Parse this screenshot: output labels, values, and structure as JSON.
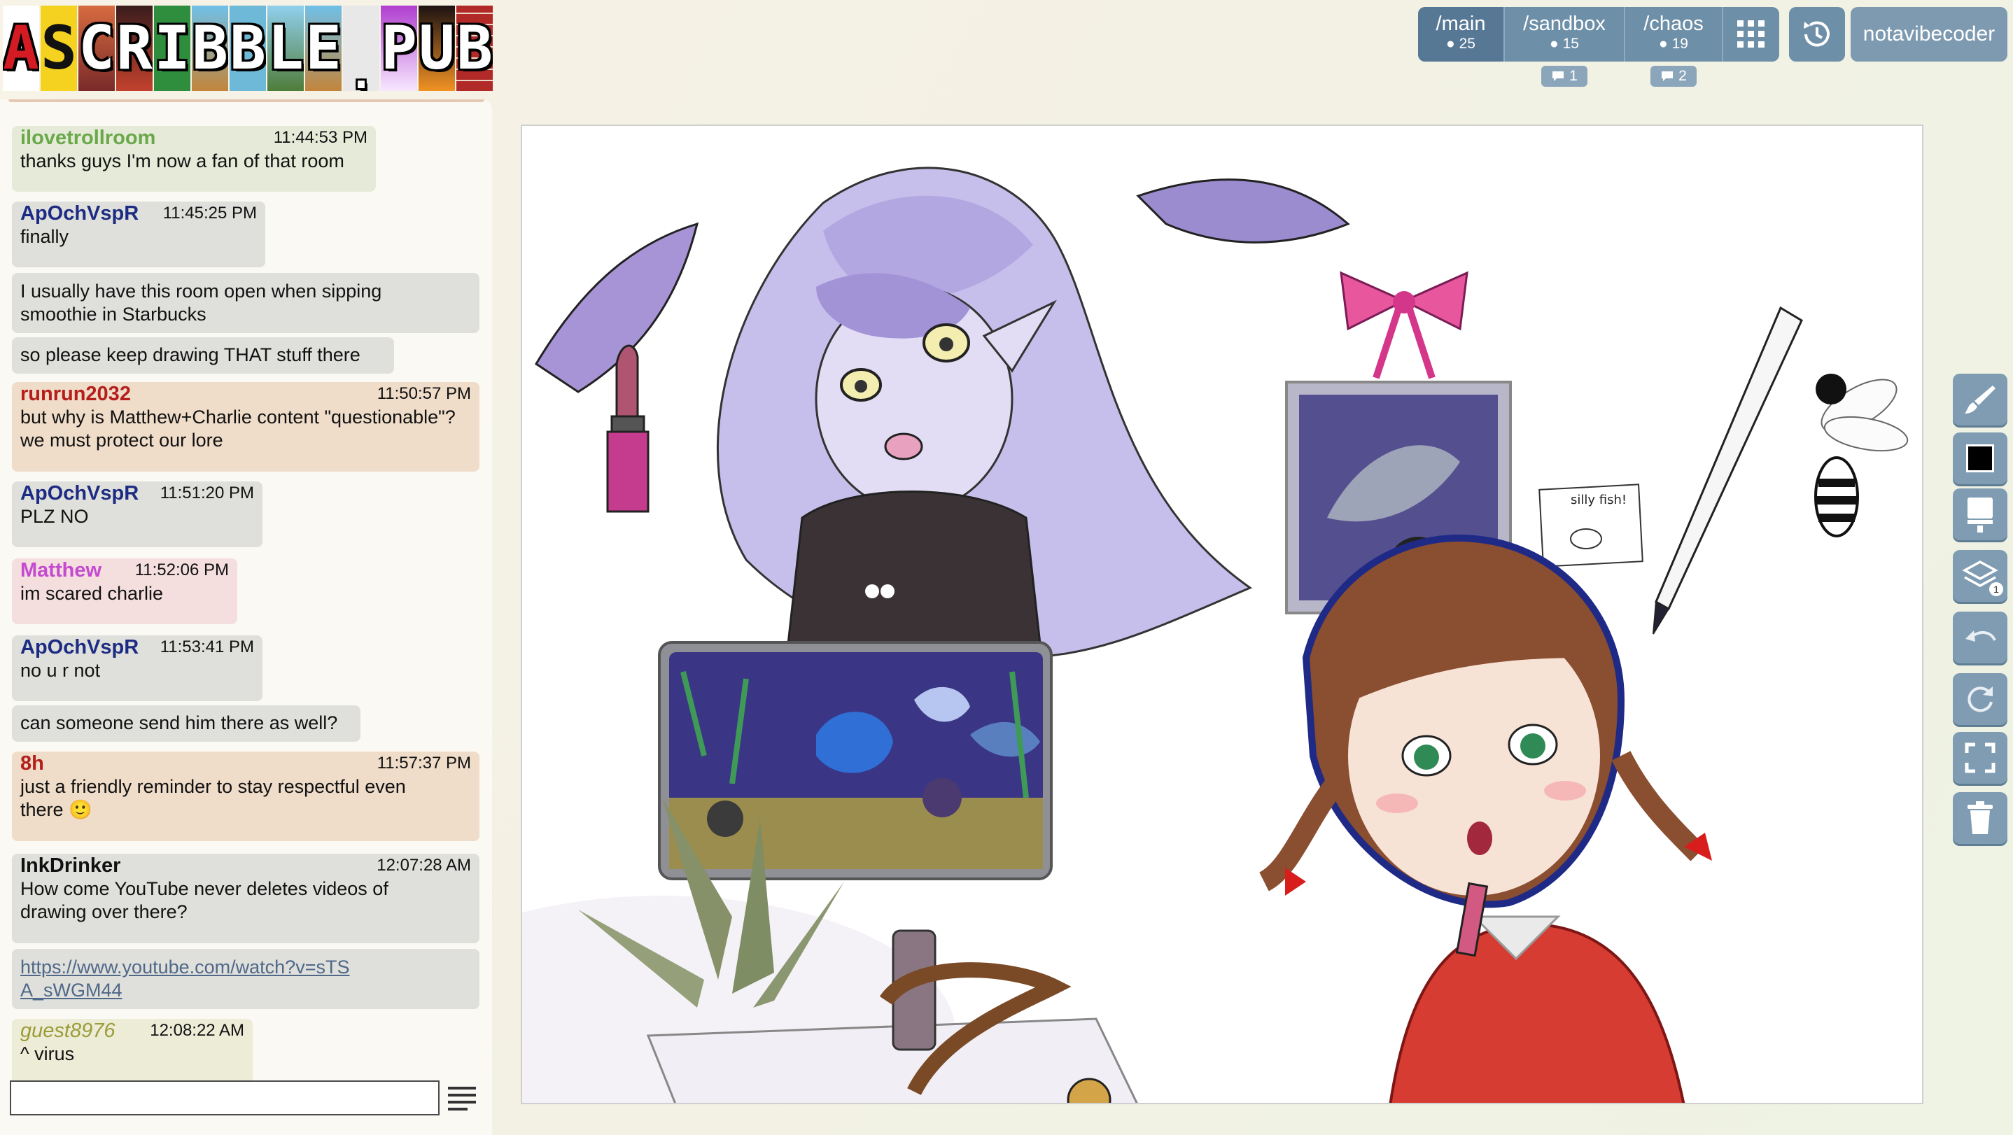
{
  "logo": {
    "text": "SCRIBBLE.PUB",
    "letters": [
      "A",
      "S",
      "C",
      "R",
      "I",
      "B",
      "B",
      "L",
      "E",
      ".",
      "P",
      "U",
      "B"
    ]
  },
  "header": {
    "rooms": [
      {
        "name": "/main",
        "count": "25"
      },
      {
        "name": "/sandbox",
        "count": "15",
        "unread": "1"
      },
      {
        "name": "/chaos",
        "count": "19",
        "unread": "2"
      }
    ],
    "username": "notavibecoder"
  },
  "chat": {
    "input_value": "",
    "messages": [
      {
        "user": "ilovetrollroom",
        "time": "11:44:53 PM",
        "text": "thanks guys I'm now a fan of that room"
      },
      {
        "user": "ApOchVspR",
        "time": "11:45:25 PM",
        "text": "finally"
      },
      {
        "text": "I usually have this room open when sipping smoothie in Starbucks"
      },
      {
        "text": "so please keep drawing THAT stuff there"
      },
      {
        "user": "runrun2032",
        "time": "11:50:57 PM",
        "text": "but why is Matthew+Charlie content \"questionable\"? we must protect our lore"
      },
      {
        "user": "ApOchVspR",
        "time": "11:51:20 PM",
        "text": "PLZ NO"
      },
      {
        "user": "Matthew",
        "time": "11:52:06 PM",
        "text": "im scared charlie"
      },
      {
        "user": "ApOchVspR",
        "time": "11:53:41 PM",
        "text": "no u r not"
      },
      {
        "text": "can someone send him there as well?"
      },
      {
        "user": "8h",
        "time": "11:57:37 PM",
        "text": "just a friendly reminder to stay respectful even there 🙂"
      },
      {
        "user": "InkDrinker",
        "time": "12:07:28 AM",
        "text": "How come YouTube never deletes videos of drawing over there?"
      },
      {
        "text": "https://www.youtube.com/watch?v=sTSA_sWGM44"
      },
      {
        "user": "guest8976",
        "time": "12:08:22 AM",
        "text": "^ virus"
      }
    ]
  },
  "canvas": {
    "sign_text": "silly fish!"
  },
  "toolbar": {
    "tools": [
      "brush-icon",
      "color-swatch",
      "eraser-icon",
      "layers-icon",
      "undo-icon",
      "redo-icon",
      "fullscreen-icon",
      "trash-icon"
    ],
    "current_color": "#000000",
    "layer_count": "1"
  },
  "colors": {
    "nav_bg": "#6e8fa8",
    "nav_active": "#577895",
    "tool_bg": "#7f9cb2"
  }
}
